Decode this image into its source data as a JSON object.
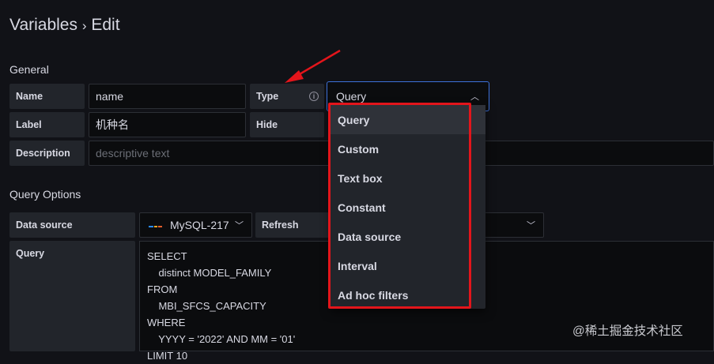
{
  "page": {
    "title": "Variables",
    "separator": "›",
    "title_suffix": "Edit"
  },
  "general": {
    "heading": "General",
    "name_label": "Name",
    "name_value": "name",
    "type_label": "Type",
    "type_value": "Query",
    "label_label": "Label",
    "label_value": "机种名",
    "hide_label": "Hide",
    "description_label": "Description",
    "description_placeholder": "descriptive text"
  },
  "type_dropdown": {
    "options": [
      "Query",
      "Custom",
      "Text box",
      "Constant",
      "Data source",
      "Interval",
      "Ad hoc filters"
    ],
    "selected": "Query"
  },
  "query_options": {
    "heading": "Query Options",
    "datasource_label": "Data source",
    "datasource_value": "MySQL-217",
    "refresh_label": "Refresh",
    "query_label": "Query",
    "query_lines": [
      "SELECT",
      "    distinct MODEL_FAMILY",
      "FROM",
      "    MBI_SFCS_CAPACITY",
      "WHERE",
      "    YYYY = '2022' AND MM = '01'",
      "LIMIT 10"
    ]
  },
  "watermark": "@稀土掘金技术社区",
  "colors": {
    "background": "#111217",
    "label_bg": "#22252b",
    "input_bg": "#0b0c0e",
    "focus_border": "#3d71d9",
    "annotation_red": "#e3151b"
  }
}
